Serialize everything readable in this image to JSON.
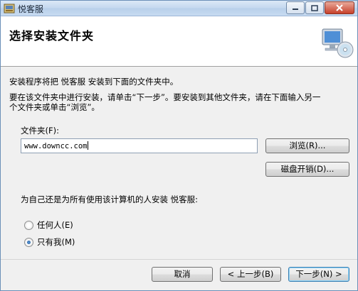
{
  "window": {
    "title": "悦客服"
  },
  "header": {
    "title": "选择安装文件夹",
    "icon": "computer-cd-icon"
  },
  "body": {
    "intro": "安装程序将把 悦客服 安装到下面的文件夹中。",
    "instruction_line1": "要在该文件夹中进行安装，请单击“下一步”。要安装到其他文件夹，请在下面输入另一",
    "instruction_line2": "个文件夹或单击“浏览”。",
    "folder_label": "文件夹(F):",
    "folder_value": "www.downcc.com",
    "browse_button": "浏览(R)...",
    "disk_cost_button": "磁盘开销(D)...",
    "install_for_question": "为自己还是为所有使用该计算机的人安装 悦客服:",
    "radio_options": [
      {
        "label": "任何人(E)",
        "checked": false
      },
      {
        "label": "只有我(M)",
        "checked": true
      }
    ]
  },
  "footer": {
    "cancel": "取消",
    "back": "< 上一步(B)",
    "next": "下一步(N) >"
  }
}
